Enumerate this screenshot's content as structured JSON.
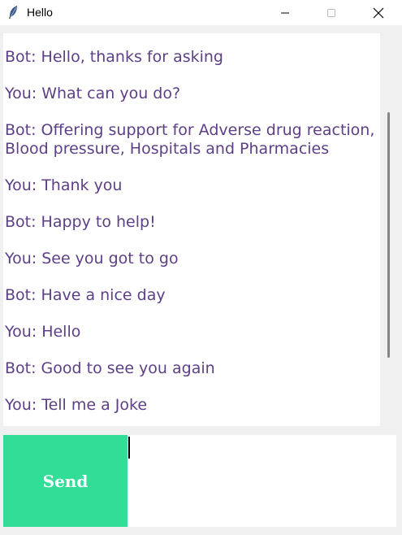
{
  "window": {
    "title": "Hello",
    "icon": "feather-icon"
  },
  "chat": {
    "messages": [
      "Bot: Hello, thanks for asking",
      "You: What can you do?",
      "Bot: Offering support for Adverse drug reaction, Blood pressure, Hospitals and Pharmacies",
      "You: Thank you",
      "Bot: Happy to help!",
      "You: See you got to go",
      "Bot: Have a nice day",
      "You: Hello",
      "Bot: Good to see you again",
      "You: Tell me a Joke"
    ],
    "text_color": "#5c3f86"
  },
  "input": {
    "value": ""
  },
  "send_button": {
    "label": "Send",
    "color": "#32de97"
  }
}
